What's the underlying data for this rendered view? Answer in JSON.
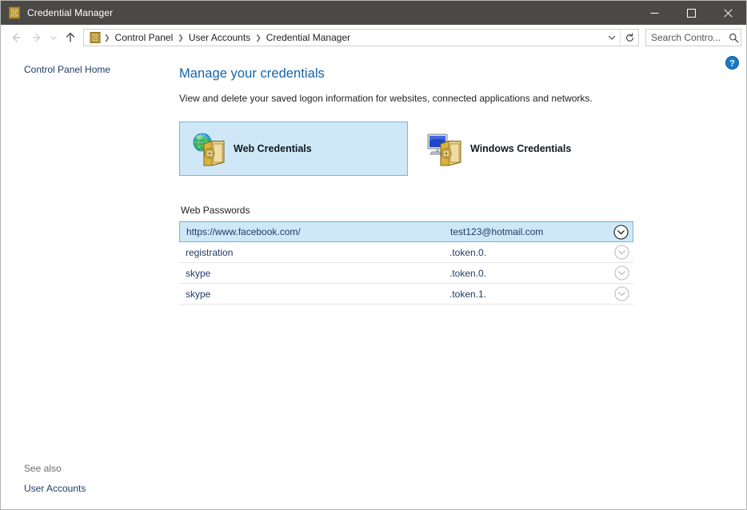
{
  "window": {
    "title": "Credential Manager",
    "title_icon": "vault-icon",
    "controls": {
      "minimize_label": "—",
      "maximize_label": "□",
      "close_label": "×"
    }
  },
  "nav": {
    "back_icon": "arrow-left-icon",
    "forward_icon": "arrow-right-icon",
    "recent_icon": "chevron-down-icon",
    "up_icon": "arrow-up-icon",
    "address_icon": "vault-icon",
    "breadcrumb": [
      "Control Panel",
      "User Accounts",
      "Credential Manager"
    ],
    "breadcrumb_separator": "❯",
    "dropdown_icon": "chevron-down-icon",
    "refresh_icon": "refresh-icon"
  },
  "search": {
    "placeholder": "Search Contro...",
    "value": "",
    "icon": "search-icon"
  },
  "sidebar": {
    "home_link": "Control Panel Home",
    "see_also_label": "See also",
    "see_also_links": [
      "User Accounts"
    ]
  },
  "main": {
    "help_icon": "help-icon",
    "title": "Manage your credentials",
    "subtitle": "View and delete your saved logon information for websites, connected applications and networks.",
    "tiles": [
      {
        "label": "Web Credentials",
        "icon": "globe-vault-icon",
        "selected": true
      },
      {
        "label": "Windows Credentials",
        "icon": "monitor-vault-icon",
        "selected": false
      }
    ],
    "web_passwords": {
      "heading": "Web Passwords",
      "expand_icon": "chevron-down-circle-icon",
      "rows": [
        {
          "target": "https://www.facebook.com/",
          "username": "test123@hotmail.com",
          "selected": true
        },
        {
          "target": "registration",
          "username": ".token.0.",
          "selected": false
        },
        {
          "target": "skype",
          "username": ".token.0.",
          "selected": false
        },
        {
          "target": "skype",
          "username": ".token.1.",
          "selected": false
        }
      ]
    }
  },
  "colors": {
    "titlebar_bg": "#4b4947",
    "accent_heading": "#1364a6",
    "link_text": "#1f3c68",
    "selection_bg": "#cfe8f7",
    "selection_border": "#7eb4d8",
    "help_blue": "#1879c4"
  }
}
